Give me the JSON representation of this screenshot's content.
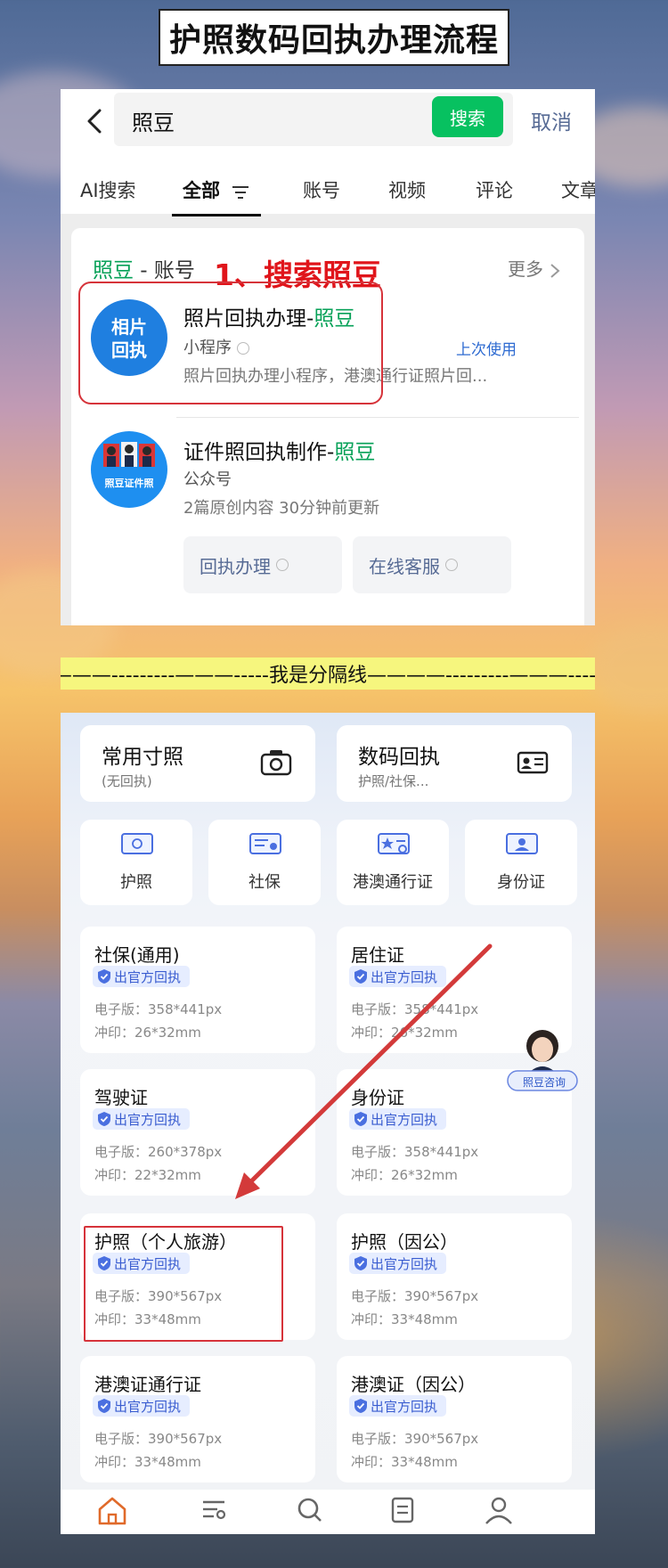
{
  "page_title": "护照数码回执办理流程",
  "search": {
    "query": "照豆",
    "search_button": "搜索",
    "cancel": "取消",
    "tabs": [
      "AI搜索",
      "全部",
      "账号",
      "视频",
      "评论",
      "文章"
    ],
    "active_tab": "全部"
  },
  "account_card": {
    "header_brand": "照豆",
    "header_rest": " - 账号",
    "more": "更多",
    "step_note": "1、搜索照豆",
    "items": [
      {
        "icon_text": "相片回执",
        "title_prefix": "照片回执办理-",
        "title_brand": "照豆",
        "type": "小程序",
        "badge": "上次使用",
        "desc": "照片回执办理小程序，港澳通行证照片回..."
      },
      {
        "icon_text": "照豆证件照",
        "title_prefix": "证件照回执制作-",
        "title_brand": "照豆",
        "type": "公众号",
        "meta": "2篇原创内容  30分钟前更新",
        "buttons": [
          "回执办理",
          "在线客服"
        ]
      }
    ]
  },
  "divider_text": "———---------———-----我是分隔线————---------———-----",
  "miniapp": {
    "big_cards": [
      {
        "title": "常用寸照",
        "sub": "(无回执)",
        "icon": "camera-icon"
      },
      {
        "title": "数码回执",
        "sub": "护照/社保...",
        "icon": "id-card-icon"
      }
    ],
    "doc_cards": [
      {
        "label": "护照",
        "icon": "passport-icon"
      },
      {
        "label": "社保",
        "icon": "social-security-icon"
      },
      {
        "label": "港澳通行证",
        "icon": "travel-permit-icon"
      },
      {
        "label": "身份证",
        "icon": "id-card-icon"
      }
    ],
    "specs": [
      {
        "name": "社保(通用)",
        "badge": "出官方回执",
        "digital": "电子版：358*441px",
        "print": "冲印：26*32mm"
      },
      {
        "name": "居住证",
        "badge": "出官方回执",
        "digital": "电子版：358*441px",
        "print": "冲印：26*32mm"
      },
      {
        "name": "驾驶证",
        "badge": "出官方回执",
        "digital": "电子版：260*378px",
        "print": "冲印：22*32mm"
      },
      {
        "name": "身份证",
        "badge": "出官方回执",
        "digital": "电子版：358*441px",
        "print": "冲印：26*32mm"
      },
      {
        "name": "护照（个人旅游）",
        "badge": "出官方回执",
        "digital": "电子版：390*567px",
        "print": "冲印：33*48mm"
      },
      {
        "name": "护照（因公）",
        "badge": "出官方回执",
        "digital": "电子版：390*567px",
        "print": "冲印：33*48mm"
      },
      {
        "name": "港澳证通行证",
        "badge": "出官方回执",
        "digital": "电子版：390*567px",
        "print": "冲印：33*48mm"
      },
      {
        "name": "港澳证（因公）",
        "badge": "出官方回执",
        "digital": "电子版：390*567px",
        "print": "冲印：33*48mm"
      }
    ],
    "advisor_label": "照豆咨询",
    "nav": [
      "home-icon",
      "category-icon",
      "search-icon",
      "orders-icon",
      "profile-icon"
    ]
  },
  "colors": {
    "wechat_green": "#07c160",
    "brand_green": "#07a158",
    "link_blue": "#576b95",
    "highlight_red": "#d6333a",
    "badge_blue": "#3a5dd0"
  }
}
